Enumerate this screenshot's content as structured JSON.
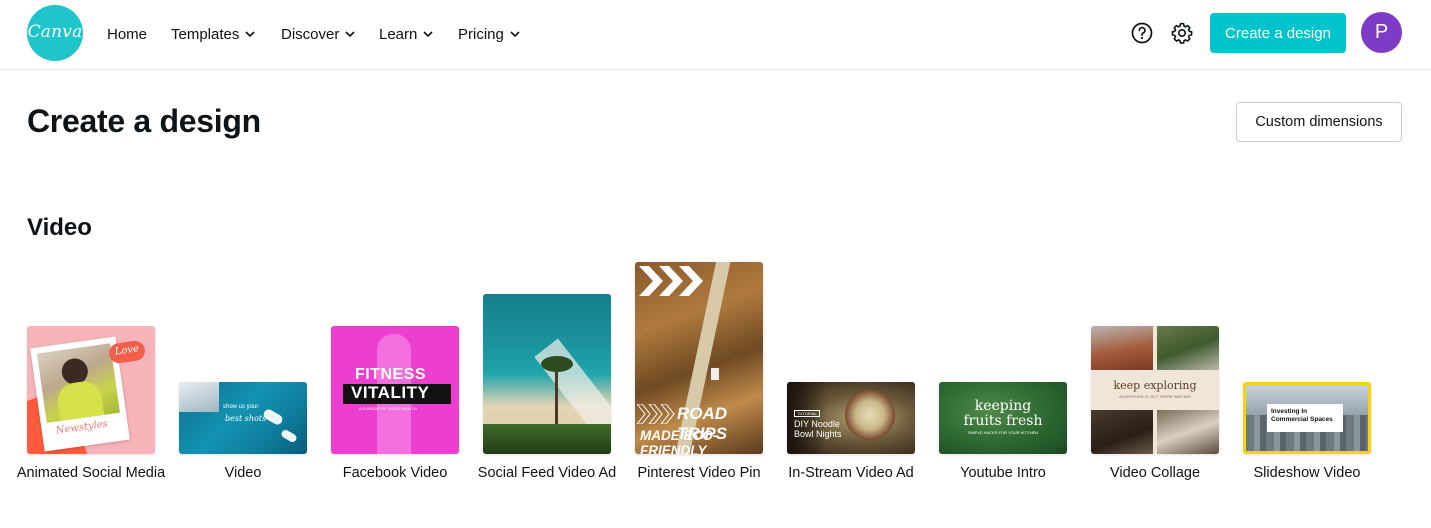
{
  "header": {
    "logo_text": "Canva",
    "nav": [
      {
        "label": "Home",
        "has_dropdown": false
      },
      {
        "label": "Templates",
        "has_dropdown": true
      },
      {
        "label": "Discover",
        "has_dropdown": true
      },
      {
        "label": "Learn",
        "has_dropdown": true
      },
      {
        "label": "Pricing",
        "has_dropdown": true
      }
    ],
    "help_icon": "help-circle-icon",
    "settings_icon": "gear-icon",
    "create_button": "Create a design",
    "avatar_initial": "P"
  },
  "page": {
    "title": "Create a design",
    "custom_dimensions_button": "Custom dimensions"
  },
  "section": {
    "title": "Video",
    "cards": [
      {
        "label": "Animated Social Media",
        "thumb_text": [
          "Love",
          "Newstyles"
        ]
      },
      {
        "label": "Video",
        "thumb_text": [
          "show us your",
          "best shots"
        ]
      },
      {
        "label": "Facebook Video",
        "thumb_text": [
          "FITNESS",
          "VITALITY",
          "A PURSUIT OF GOOD HEALTH"
        ]
      },
      {
        "label": "Social Feed Video Ad",
        "thumb_text": []
      },
      {
        "label": "Pinterest Video Pin",
        "thumb_text": [
          "ROAD TRIPS",
          "MADE ECO-FRIENDLY"
        ]
      },
      {
        "label": "In-Stream Video Ad",
        "thumb_text": [
          "TUTORIAL",
          "DIY Noodle",
          "Bowl Nights"
        ]
      },
      {
        "label": "Youtube Intro",
        "thumb_text": [
          "keeping",
          "fruits fresh",
          "SIMPLE HACKS FOR YOUR KITCHEN"
        ]
      },
      {
        "label": "Video Collage",
        "thumb_text": [
          "keep exploring",
          "ADVENTURE IS OUT THERE WAITING"
        ]
      },
      {
        "label": "Slideshow Video",
        "thumb_text": [
          "Investing In",
          "Commercial Spaces"
        ]
      }
    ]
  },
  "colors": {
    "accent": "#00c4cc",
    "avatar": "#7d3bc7",
    "text": "#0e1318"
  }
}
